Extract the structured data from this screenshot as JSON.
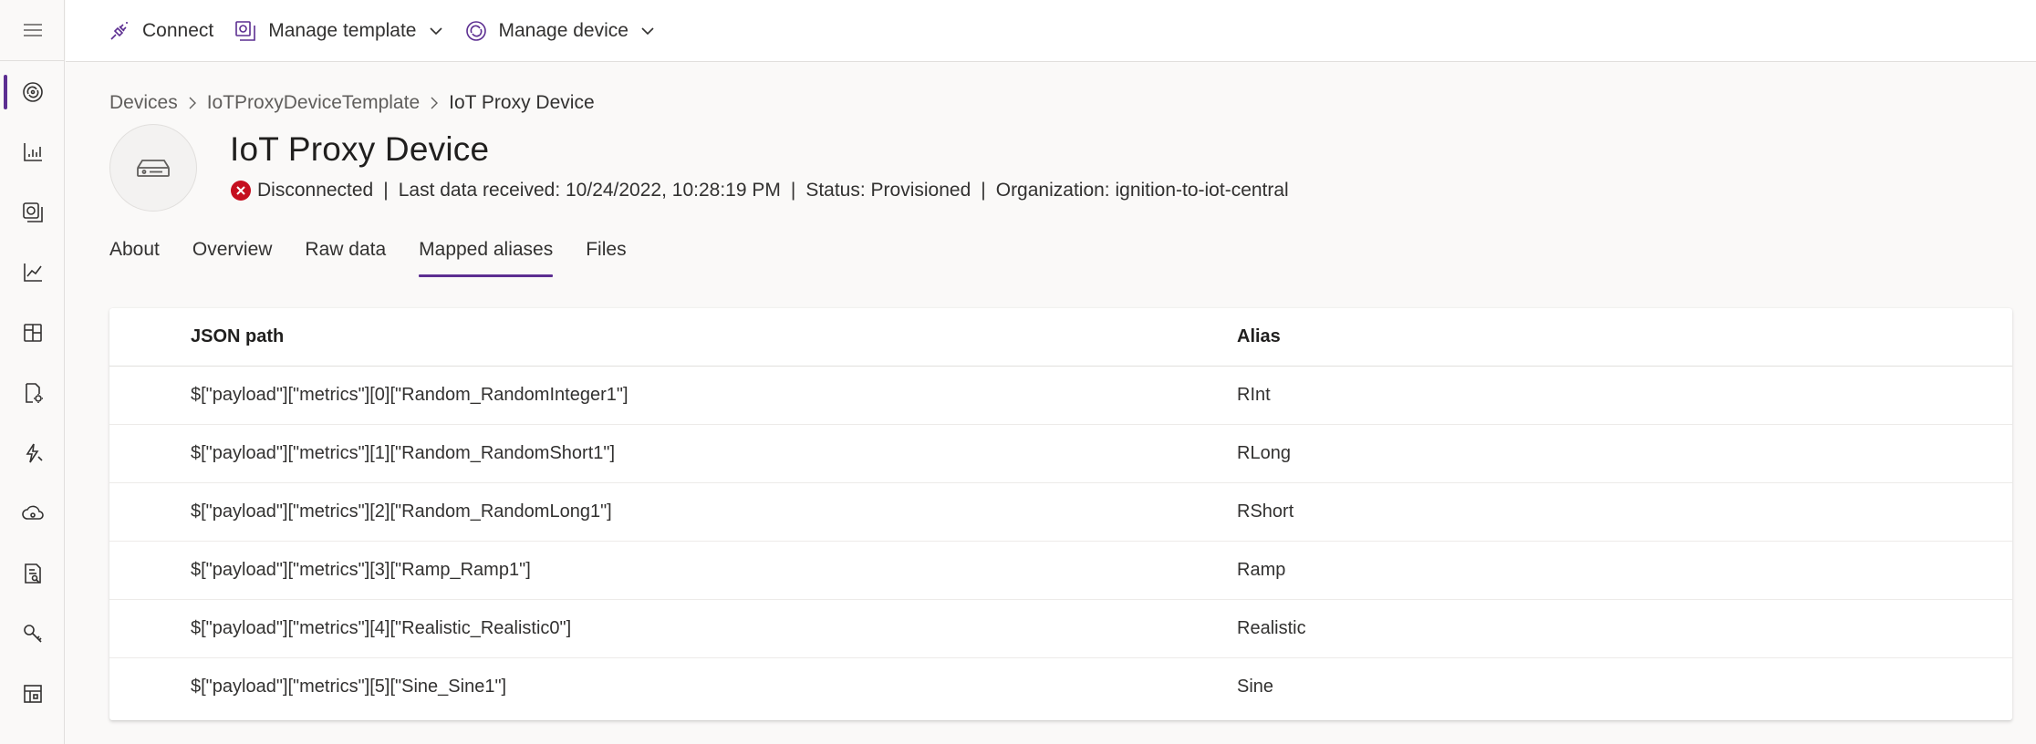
{
  "toolbar": {
    "connect_label": "Connect",
    "manage_template_label": "Manage template",
    "manage_device_label": "Manage device"
  },
  "breadcrumb": [
    "Devices",
    "IoTProxyDeviceTemplate",
    "IoT Proxy Device"
  ],
  "device": {
    "title": "IoT Proxy Device",
    "connection_status": "Disconnected",
    "last_data": "Last data received: 10/24/2022, 10:28:19 PM",
    "status": "Status: Provisioned",
    "organization": "Organization: ignition-to-iot-central",
    "separator": "|"
  },
  "tabs": [
    "About",
    "Overview",
    "Raw data",
    "Mapped aliases",
    "Files"
  ],
  "active_tab": "Mapped aliases",
  "table": {
    "columns": [
      "JSON path",
      "Alias"
    ],
    "rows": [
      [
        "$[\"payload\"][\"metrics\"][0][\"Random_RandomInteger1\"]",
        "RInt"
      ],
      [
        "$[\"payload\"][\"metrics\"][1][\"Random_RandomShort1\"]",
        "RLong"
      ],
      [
        "$[\"payload\"][\"metrics\"][2][\"Random_RandomLong1\"]",
        "RShort"
      ],
      [
        "$[\"payload\"][\"metrics\"][3][\"Ramp_Ramp1\"]",
        "Ramp"
      ],
      [
        "$[\"payload\"][\"metrics\"][4][\"Realistic_Realistic0\"]",
        "Realistic"
      ],
      [
        "$[\"payload\"][\"metrics\"][5][\"Sine_Sine1\"]",
        "Sine"
      ]
    ]
  },
  "colors": {
    "accent": "#5c2e91",
    "error": "#c50f1f"
  },
  "icons": {
    "rail": [
      "menu-icon",
      "devices-icon",
      "dashboard-icon",
      "device-groups-icon",
      "analytics-icon",
      "device-templates-icon",
      "data-export-icon",
      "jobs-icon",
      "iot-edge-icon",
      "audit-logs-icon",
      "permissions-icon",
      "customization-icon"
    ]
  }
}
